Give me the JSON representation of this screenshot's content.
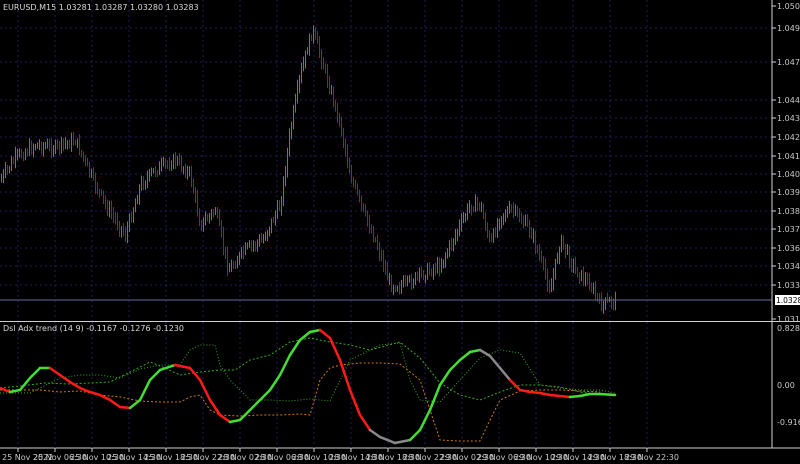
{
  "main_panel": {
    "title": "EURUSD,M15  1.03281 1.03287 1.03280 1.03283",
    "price_labels": [
      "1.05030",
      "1.04920",
      "1.04700",
      "1.04480",
      "1.04370",
      "1.04260",
      "1.04150",
      "1.04040",
      "1.03930",
      "1.03820",
      "1.03710",
      "1.03600",
      "1.03490",
      "1.03380",
      "1.03160"
    ],
    "current_price": "1.03283",
    "colors": {
      "bull": "#00c000",
      "bear": "#e00000",
      "grid": "#1e1e5a",
      "current_line": "#6a6a9a",
      "price_tag_bg": "#ffffff",
      "price_tag_text": "#000000"
    }
  },
  "indicator_panel": {
    "title": "Dsl Adx trend (14 9) -0.1167 -0.1276 -0.1230",
    "scale_labels": [
      "0.8285",
      "0.00",
      "-0.9161"
    ],
    "colors": {
      "up": "#44dd33",
      "down": "#ff1a1a",
      "neutral": "#8a8a8a",
      "signal": "#33aa22",
      "level": "#cc7a1a"
    }
  },
  "time_axis": {
    "labels": [
      "25 Nov 2022",
      "25 Nov 06:30",
      "25 Nov 10:30",
      "25 Nov 14:30",
      "25 Nov 18:30",
      "25 Nov 22:30",
      "28 Nov 02:30",
      "28 Nov 06:30",
      "28 Nov 10:30",
      "28 Nov 14:30",
      "28 Nov 18:30",
      "28 Nov 22:30",
      "29 Nov 02:30",
      "29 Nov 06:30",
      "29 Nov 10:30",
      "29 Nov 14:30",
      "29 Nov 18:30",
      "29 Nov 22:30"
    ]
  }
}
